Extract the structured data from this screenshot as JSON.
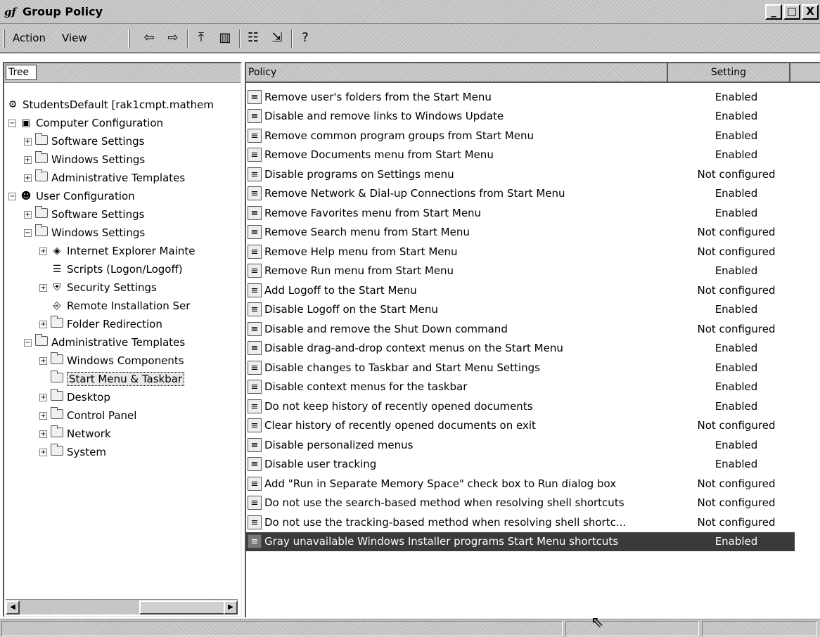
{
  "window": {
    "title": "Group Policy",
    "title_icon": "gf",
    "buttons": {
      "minimize": "_",
      "maximize": "□",
      "close": "X"
    }
  },
  "menu": {
    "action": "Action",
    "view": "View"
  },
  "toolbar": {
    "icons": [
      "back-arrow-icon",
      "forward-arrow-icon",
      "up-folder-icon",
      "show-hide-tree-icon",
      "properties-icon",
      "export-list-icon",
      "help-icon"
    ]
  },
  "tree": {
    "tab_label": "Tree",
    "nodes": [
      {
        "label": "StudentsDefault [rak1cmpt.mathem",
        "icon": "policy-root-icon"
      },
      {
        "label": "Computer Configuration",
        "icon": "computer-icon"
      },
      {
        "label": "Software Settings",
        "icon": "folder-icon"
      },
      {
        "label": "Windows Settings",
        "icon": "folder-icon"
      },
      {
        "label": "Administrative Templates",
        "icon": "folder-icon"
      },
      {
        "label": "User Configuration",
        "icon": "user-icon"
      },
      {
        "label": "Software Settings",
        "icon": "folder-icon"
      },
      {
        "label": "Windows Settings",
        "icon": "folder-icon"
      },
      {
        "label": "Internet Explorer Mainte",
        "icon": "internet-explorer-icon"
      },
      {
        "label": "Scripts (Logon/Logoff)",
        "icon": "scripts-icon"
      },
      {
        "label": "Security Settings",
        "icon": "security-icon"
      },
      {
        "label": "Remote Installation Ser",
        "icon": "remote-install-icon"
      },
      {
        "label": "Folder Redirection",
        "icon": "folder-icon"
      },
      {
        "label": "Administrative Templates",
        "icon": "folder-icon"
      },
      {
        "label": "Windows Components",
        "icon": "folder-icon"
      },
      {
        "label": "Start Menu & Taskbar",
        "icon": "folder-icon"
      },
      {
        "label": "Desktop",
        "icon": "folder-icon"
      },
      {
        "label": "Control Panel",
        "icon": "folder-icon"
      },
      {
        "label": "Network",
        "icon": "folder-icon"
      },
      {
        "label": "System",
        "icon": "folder-icon"
      }
    ]
  },
  "list": {
    "columns": {
      "policy": "Policy",
      "setting": "Setting"
    },
    "rows": [
      {
        "policy": "Remove user's folders from the Start Menu",
        "setting": "Enabled"
      },
      {
        "policy": "Disable and remove links to Windows Update",
        "setting": "Enabled"
      },
      {
        "policy": "Remove common program groups from Start Menu",
        "setting": "Enabled"
      },
      {
        "policy": "Remove Documents menu from Start Menu",
        "setting": "Enabled"
      },
      {
        "policy": "Disable programs on Settings menu",
        "setting": "Not configured"
      },
      {
        "policy": "Remove Network & Dial-up Connections from Start Menu",
        "setting": "Enabled"
      },
      {
        "policy": "Remove Favorites menu from Start Menu",
        "setting": "Enabled"
      },
      {
        "policy": "Remove Search menu from Start Menu",
        "setting": "Not configured"
      },
      {
        "policy": "Remove Help menu from Start Menu",
        "setting": "Not configured"
      },
      {
        "policy": "Remove Run menu from Start Menu",
        "setting": "Enabled"
      },
      {
        "policy": "Add Logoff to the Start Menu",
        "setting": "Not configured"
      },
      {
        "policy": "Disable Logoff on the Start Menu",
        "setting": "Enabled"
      },
      {
        "policy": "Disable and remove the Shut Down command",
        "setting": "Not configured"
      },
      {
        "policy": "Disable drag-and-drop context menus on the Start Menu",
        "setting": "Enabled"
      },
      {
        "policy": "Disable changes to Taskbar and Start Menu Settings",
        "setting": "Enabled"
      },
      {
        "policy": "Disable context menus for the taskbar",
        "setting": "Enabled"
      },
      {
        "policy": "Do not keep history of recently opened documents",
        "setting": "Enabled"
      },
      {
        "policy": "Clear history of recently opened documents on exit",
        "setting": "Not configured"
      },
      {
        "policy": "Disable personalized menus",
        "setting": "Enabled"
      },
      {
        "policy": "Disable user tracking",
        "setting": "Enabled"
      },
      {
        "policy": "Add \"Run in Separate Memory Space\" check box to Run dialog box",
        "setting": "Not configured"
      },
      {
        "policy": "Do not use the search-based method when resolving shell shortcuts",
        "setting": "Not configured"
      },
      {
        "policy": "Do not use the tracking-based method when resolving shell shortc...",
        "setting": "Not configured"
      },
      {
        "policy": "Gray unavailable Windows Installer programs Start Menu shortcuts",
        "setting": "Enabled"
      }
    ]
  }
}
